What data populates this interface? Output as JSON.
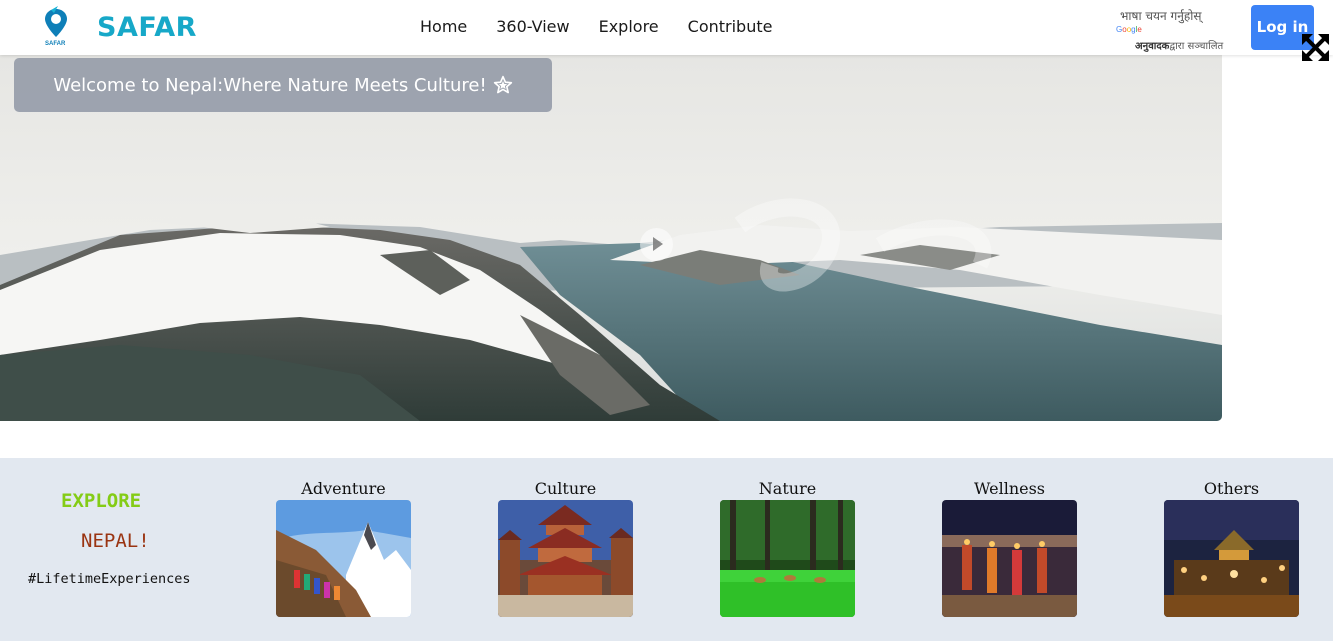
{
  "navbar": {
    "brand": "SAFAR",
    "logo_text": "SAFAR",
    "links": [
      "Home",
      "360-View",
      "Explore",
      "Contribute"
    ],
    "translate": {
      "select_label": "भाषा चयन गर्नुहोस्",
      "google_word": "Google",
      "powered_bold": "अनुवादक",
      "powered_rest": "द्वारा सञ्चालित"
    },
    "login_label": "Log in"
  },
  "hero": {
    "welcome_text": "Welcome to Nepal:Where Nature Meets Culture!",
    "icons": {
      "star": "star-icon",
      "play": "play-icon",
      "fullscreen": "fullscreen-icon"
    }
  },
  "explore": {
    "title": "EXPLORE",
    "subtitle": "NEPAL!",
    "tagline": "#LifetimeExperiences",
    "categories": [
      {
        "label": "Adventure"
      },
      {
        "label": "Culture"
      },
      {
        "label": "Nature"
      },
      {
        "label": "Wellness"
      },
      {
        "label": "Others"
      }
    ]
  },
  "colors": {
    "brand": "#17a8c8",
    "login": "#3b82f6",
    "explore_green": "#84cc16",
    "explore_brown": "#9a3412",
    "strip_bg": "#e2e8f0"
  }
}
